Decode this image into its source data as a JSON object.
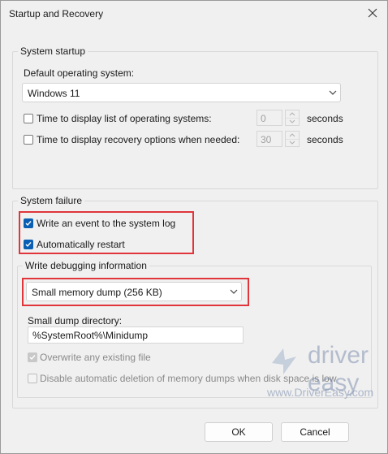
{
  "window": {
    "title": "Startup and Recovery"
  },
  "system_startup": {
    "group_label": "System startup",
    "default_os_label": "Default operating system:",
    "default_os_value": "Windows 11",
    "time_list_label": "Time to display list of operating systems:",
    "time_list_checked": false,
    "time_list_value": "0",
    "time_recovery_label": "Time to display recovery options when needed:",
    "time_recovery_checked": false,
    "time_recovery_value": "30",
    "seconds_unit": "seconds"
  },
  "system_failure": {
    "group_label": "System failure",
    "write_event_label": "Write an event to the system log",
    "write_event_checked": true,
    "auto_restart_label": "Automatically restart",
    "auto_restart_checked": true
  },
  "debugging": {
    "group_label": "Write debugging information",
    "dump_type_value": "Small memory dump (256 KB)",
    "dir_label": "Small dump directory:",
    "dir_value": "%SystemRoot%\\Minidump",
    "overwrite_label": "Overwrite any existing file",
    "overwrite_checked": true,
    "overwrite_disabled": true,
    "disable_auto_delete_label": "Disable automatic deletion of memory dumps when disk space is low",
    "disable_auto_delete_checked": false,
    "disable_auto_delete_disabled": true
  },
  "watermark": {
    "text": "driver easy",
    "url": "www.DriverEasy.com"
  },
  "buttons": {
    "ok": "OK",
    "cancel": "Cancel"
  },
  "colors": {
    "accent": "#0a5fb4",
    "highlight": "#e0363b",
    "background": "#f0f0f0"
  },
  "icons": {
    "close": "close-icon",
    "dropdown": "chevron-down-icon",
    "checkbox": "check-icon",
    "spin_up": "chevron-up-icon",
    "spin_down": "chevron-down-icon",
    "watermark_logo": "driver-easy-logo"
  }
}
